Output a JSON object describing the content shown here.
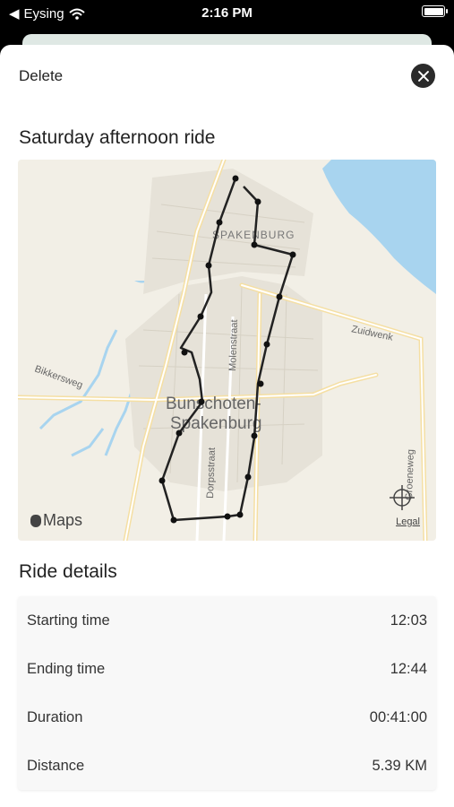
{
  "status_bar": {
    "carrier": "Eysing",
    "time": "2:16 PM"
  },
  "sheet": {
    "delete_label": "Delete",
    "ride_title": "Saturday afternoon ride",
    "map": {
      "place_labels": [
        "SPAKENBURG",
        "Bunschoten-",
        "Spakenburg"
      ],
      "street_labels": [
        "Zuidwenk",
        "Molenstraat",
        "Bikkersweg",
        "Dorpsstraat",
        "Groeneweg"
      ],
      "maps_label": "Maps",
      "legal_label": "Legal"
    },
    "details_title": "Ride details",
    "details": [
      {
        "label": "Starting time",
        "value": "12:03"
      },
      {
        "label": "Ending time",
        "value": "12:44"
      },
      {
        "label": "Duration",
        "value": "00:41:00"
      },
      {
        "label": "Distance",
        "value": "5.39 KM"
      }
    ]
  }
}
